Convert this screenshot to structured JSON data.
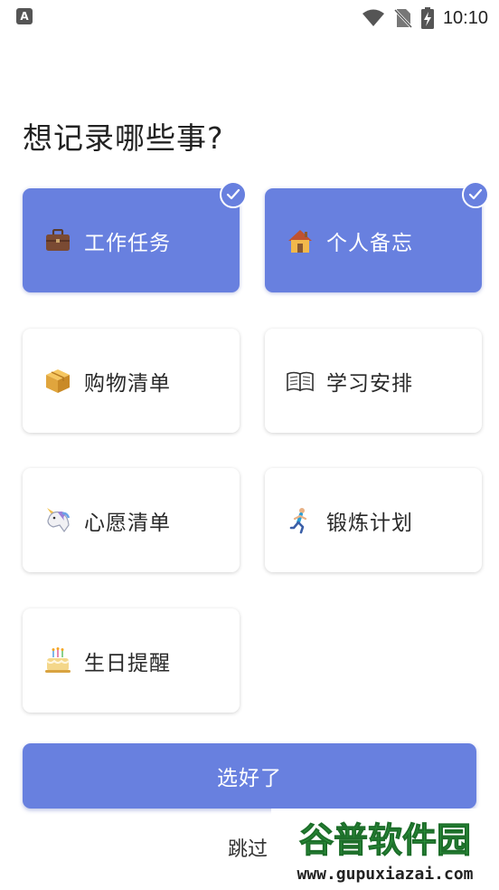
{
  "status_bar": {
    "left_icon": "A",
    "time": "10:10",
    "icons": [
      "wifi-icon",
      "no-sim-icon",
      "battery-charging-icon"
    ]
  },
  "title": "想记录哪些事?",
  "categories": [
    {
      "label": "工作任务",
      "icon": "briefcase-icon",
      "selected": true
    },
    {
      "label": "个人备忘",
      "icon": "house-icon",
      "selected": true
    },
    {
      "label": "购物清单",
      "icon": "package-icon",
      "selected": false
    },
    {
      "label": "学习安排",
      "icon": "open-book-icon",
      "selected": false
    },
    {
      "label": "心愿清单",
      "icon": "unicorn-icon",
      "selected": false
    },
    {
      "label": "锻炼计划",
      "icon": "runner-icon",
      "selected": false
    },
    {
      "label": "生日提醒",
      "icon": "birthday-cake-icon",
      "selected": false
    }
  ],
  "confirm_label": "选好了",
  "skip_label": "跳过",
  "watermark": {
    "title": "谷普软件园",
    "url": "www.gupuxiazai.com"
  },
  "colors": {
    "accent": "#6880df",
    "card_bg": "#ffffff"
  }
}
